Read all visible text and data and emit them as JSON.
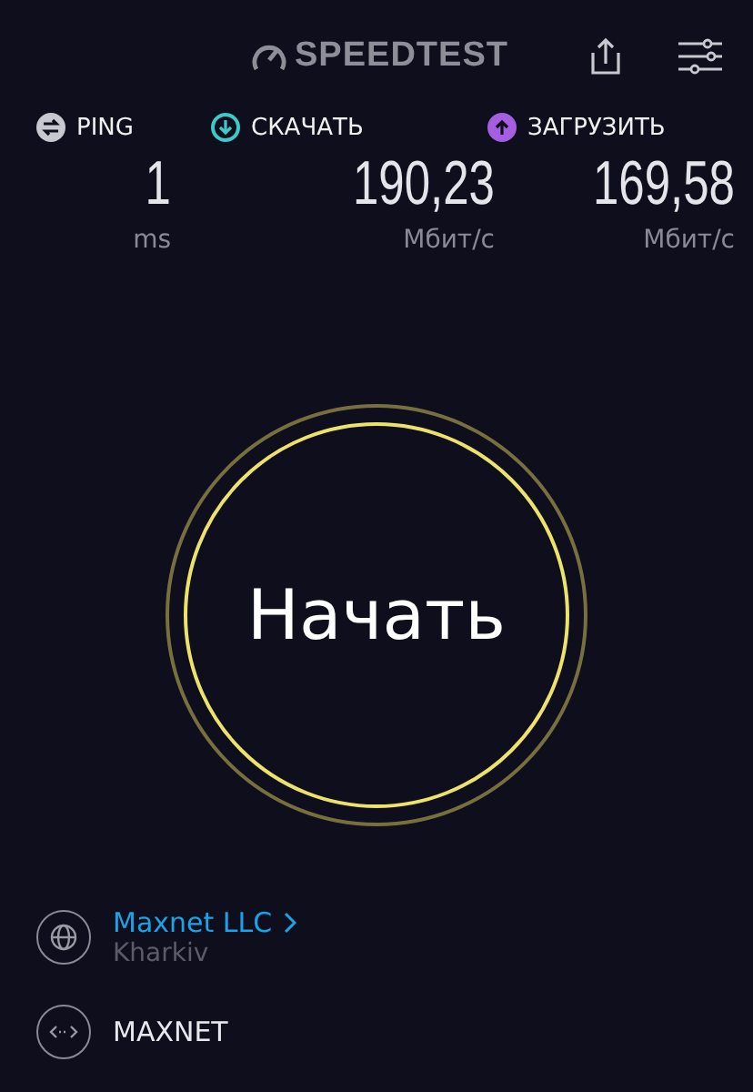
{
  "header": {
    "logo": "SPEEDTEST"
  },
  "metrics": [
    {
      "kind": "ping",
      "label": "PING",
      "value": "1",
      "unit": "ms",
      "color": "#c8c8d0"
    },
    {
      "kind": "download",
      "label": "СКАЧАТЬ",
      "value": "190,23",
      "unit": "Мбит/с",
      "color": "#3fc8c8"
    },
    {
      "kind": "upload",
      "label": "ЗАГРУЗИТЬ",
      "value": "169,58",
      "unit": "Мбит/с",
      "color": "#a55ee0"
    }
  ],
  "start_button": {
    "label": "Начать"
  },
  "provider": {
    "name": "Maxnet LLC",
    "location": "Kharkiv"
  },
  "server": {
    "name": "MAXNET"
  }
}
